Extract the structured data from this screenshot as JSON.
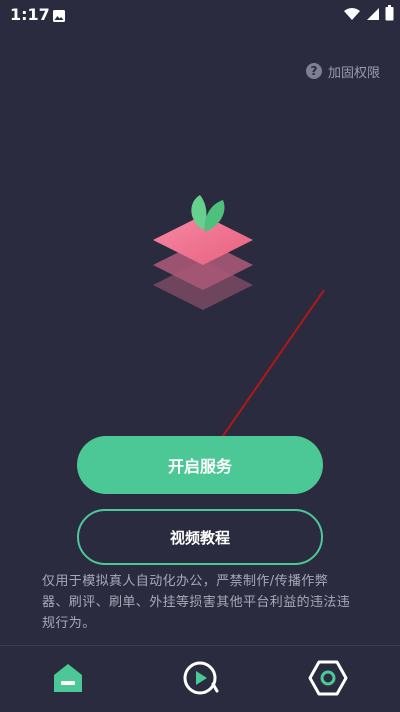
{
  "status_bar": {
    "time": "1:17",
    "icons": [
      "gallery-icon",
      "wifi-icon",
      "cellular-icon",
      "battery-icon"
    ]
  },
  "help": {
    "label": "加固权限",
    "icon": "question-icon"
  },
  "logo": {
    "icon": "layered-stack-leaf-logo"
  },
  "buttons": {
    "start_service": "开启服务",
    "video_tutorial": "视频教程"
  },
  "disclaimer": {
    "line1": "仅用于模拟真人自动化办公，严禁制作/传播作弊",
    "line2": "器、刷评、刷单、外挂等损害其他平台利益的违法违",
    "line3": "规行为。"
  },
  "bottom_nav": {
    "items": [
      {
        "icon": "home-icon",
        "active": true
      },
      {
        "icon": "video-play-icon",
        "active": false
      },
      {
        "icon": "settings-hex-icon",
        "active": false
      }
    ]
  },
  "colors": {
    "background": "#2b2b3f",
    "accent": "#4cc896",
    "logo_pink": "#f07a9a",
    "leaf_green": "#66d08e",
    "annotation_arrow": "#b01818"
  }
}
